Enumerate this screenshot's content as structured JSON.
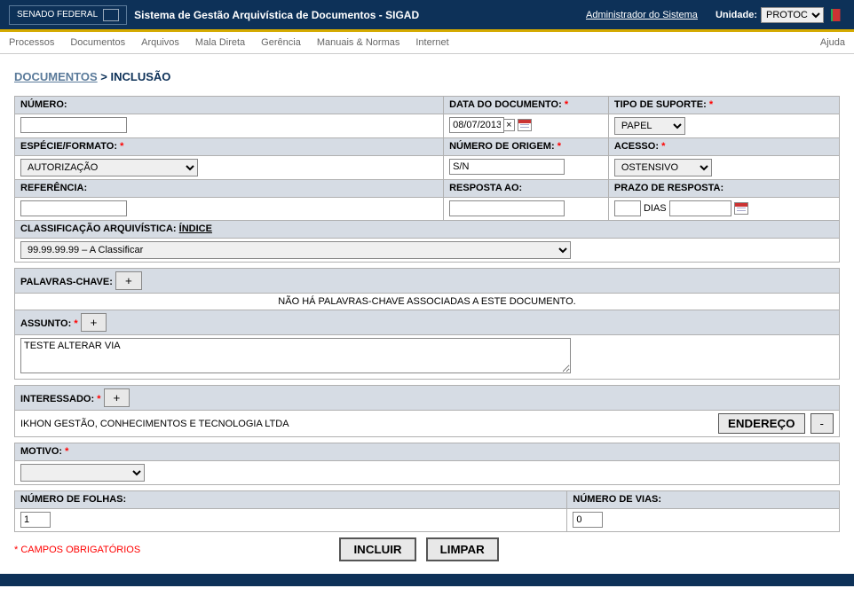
{
  "header": {
    "brand": "SENADO FEDERAL",
    "title": "Sistema de Gestão Arquivística de Documentos - SIGAD",
    "admin_link": "Administrador do Sistema",
    "unidade_label": "Unidade:",
    "unidade_value": "PROTOC"
  },
  "menu": {
    "processos": "Processos",
    "documentos": "Documentos",
    "arquivos": "Arquivos",
    "mala_direta": "Mala Direta",
    "gerencia": "Gerência",
    "manuais": "Manuais & Normas",
    "internet": "Internet",
    "ajuda": "Ajuda"
  },
  "breadcrumb": {
    "documentos": "DOCUMENTOS",
    "sep": " > ",
    "inclusao": "INCLUSÃO"
  },
  "labels": {
    "numero": "NÚMERO:",
    "data_doc": "DATA DO DOCUMENTO:",
    "tipo_suporte": "TIPO DE SUPORTE:",
    "especie": "ESPÉCIE/FORMATO:",
    "num_origem": "NÚMERO DE ORIGEM:",
    "acesso": "ACESSO:",
    "referencia": "REFERÊNCIA:",
    "resposta_ao": "RESPOSTA AO:",
    "prazo": "PRAZO DE RESPOSTA:",
    "dias": "DIAS",
    "classificacao": "CLASSIFICAÇÃO ARQUIVÍSTICA:",
    "indice": "ÍNDICE",
    "palavras": "PALAVRAS-CHAVE:",
    "assunto": "ASSUNTO:",
    "interessado": "INTERESSADO:",
    "motivo": "MOTIVO:",
    "num_folhas": "NÚMERO DE FOLHAS:",
    "num_vias": "NÚMERO DE VIAS:",
    "endereco_btn": "ENDEREÇO",
    "minus": "-",
    "plus": "+",
    "no_keywords": "NÃO HÁ PALAVRAS-CHAVE ASSOCIADAS A ESTE DOCUMENTO.",
    "required_note": "* CAMPOS OBRIGATÓRIOS",
    "incluir": "INCLUIR",
    "limpar": "LIMPAR"
  },
  "values": {
    "numero": "",
    "data_doc": "08/07/2013",
    "tipo_suporte": "PAPEL",
    "especie": "AUTORIZAÇÃO",
    "num_origem": "S/N",
    "acesso": "OSTENSIVO",
    "referencia": "",
    "resposta_ao": "",
    "prazo_dias": "",
    "prazo_data": "",
    "classificacao": "99.99.99.99 – A Classificar",
    "assunto": "TESTE ALTERAR VIA",
    "interessado": "IKHON GESTÃO, CONHECIMENTOS E TECNOLOGIA LTDA",
    "motivo": "",
    "num_folhas": "1",
    "num_vias": "0"
  }
}
